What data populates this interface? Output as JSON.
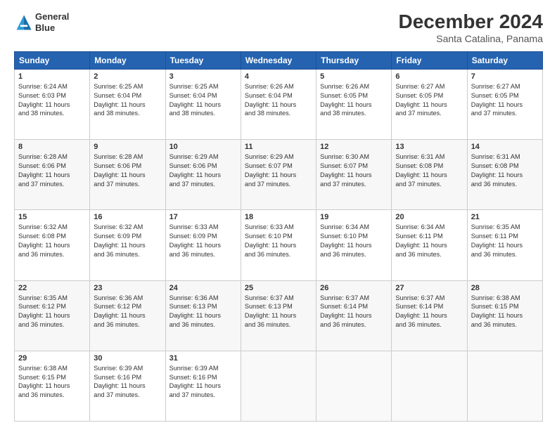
{
  "header": {
    "logo_line1": "General",
    "logo_line2": "Blue",
    "main_title": "December 2024",
    "subtitle": "Santa Catalina, Panama"
  },
  "calendar": {
    "days_of_week": [
      "Sunday",
      "Monday",
      "Tuesday",
      "Wednesday",
      "Thursday",
      "Friday",
      "Saturday"
    ],
    "weeks": [
      [
        {
          "day": "1",
          "info": "Sunrise: 6:24 AM\nSunset: 6:03 PM\nDaylight: 11 hours\nand 38 minutes."
        },
        {
          "day": "2",
          "info": "Sunrise: 6:25 AM\nSunset: 6:04 PM\nDaylight: 11 hours\nand 38 minutes."
        },
        {
          "day": "3",
          "info": "Sunrise: 6:25 AM\nSunset: 6:04 PM\nDaylight: 11 hours\nand 38 minutes."
        },
        {
          "day": "4",
          "info": "Sunrise: 6:26 AM\nSunset: 6:04 PM\nDaylight: 11 hours\nand 38 minutes."
        },
        {
          "day": "5",
          "info": "Sunrise: 6:26 AM\nSunset: 6:05 PM\nDaylight: 11 hours\nand 38 minutes."
        },
        {
          "day": "6",
          "info": "Sunrise: 6:27 AM\nSunset: 6:05 PM\nDaylight: 11 hours\nand 37 minutes."
        },
        {
          "day": "7",
          "info": "Sunrise: 6:27 AM\nSunset: 6:05 PM\nDaylight: 11 hours\nand 37 minutes."
        }
      ],
      [
        {
          "day": "8",
          "info": "Sunrise: 6:28 AM\nSunset: 6:06 PM\nDaylight: 11 hours\nand 37 minutes."
        },
        {
          "day": "9",
          "info": "Sunrise: 6:28 AM\nSunset: 6:06 PM\nDaylight: 11 hours\nand 37 minutes."
        },
        {
          "day": "10",
          "info": "Sunrise: 6:29 AM\nSunset: 6:06 PM\nDaylight: 11 hours\nand 37 minutes."
        },
        {
          "day": "11",
          "info": "Sunrise: 6:29 AM\nSunset: 6:07 PM\nDaylight: 11 hours\nand 37 minutes."
        },
        {
          "day": "12",
          "info": "Sunrise: 6:30 AM\nSunset: 6:07 PM\nDaylight: 11 hours\nand 37 minutes."
        },
        {
          "day": "13",
          "info": "Sunrise: 6:31 AM\nSunset: 6:08 PM\nDaylight: 11 hours\nand 37 minutes."
        },
        {
          "day": "14",
          "info": "Sunrise: 6:31 AM\nSunset: 6:08 PM\nDaylight: 11 hours\nand 36 minutes."
        }
      ],
      [
        {
          "day": "15",
          "info": "Sunrise: 6:32 AM\nSunset: 6:08 PM\nDaylight: 11 hours\nand 36 minutes."
        },
        {
          "day": "16",
          "info": "Sunrise: 6:32 AM\nSunset: 6:09 PM\nDaylight: 11 hours\nand 36 minutes."
        },
        {
          "day": "17",
          "info": "Sunrise: 6:33 AM\nSunset: 6:09 PM\nDaylight: 11 hours\nand 36 minutes."
        },
        {
          "day": "18",
          "info": "Sunrise: 6:33 AM\nSunset: 6:10 PM\nDaylight: 11 hours\nand 36 minutes."
        },
        {
          "day": "19",
          "info": "Sunrise: 6:34 AM\nSunset: 6:10 PM\nDaylight: 11 hours\nand 36 minutes."
        },
        {
          "day": "20",
          "info": "Sunrise: 6:34 AM\nSunset: 6:11 PM\nDaylight: 11 hours\nand 36 minutes."
        },
        {
          "day": "21",
          "info": "Sunrise: 6:35 AM\nSunset: 6:11 PM\nDaylight: 11 hours\nand 36 minutes."
        }
      ],
      [
        {
          "day": "22",
          "info": "Sunrise: 6:35 AM\nSunset: 6:12 PM\nDaylight: 11 hours\nand 36 minutes."
        },
        {
          "day": "23",
          "info": "Sunrise: 6:36 AM\nSunset: 6:12 PM\nDaylight: 11 hours\nand 36 minutes."
        },
        {
          "day": "24",
          "info": "Sunrise: 6:36 AM\nSunset: 6:13 PM\nDaylight: 11 hours\nand 36 minutes."
        },
        {
          "day": "25",
          "info": "Sunrise: 6:37 AM\nSunset: 6:13 PM\nDaylight: 11 hours\nand 36 minutes."
        },
        {
          "day": "26",
          "info": "Sunrise: 6:37 AM\nSunset: 6:14 PM\nDaylight: 11 hours\nand 36 minutes."
        },
        {
          "day": "27",
          "info": "Sunrise: 6:37 AM\nSunset: 6:14 PM\nDaylight: 11 hours\nand 36 minutes."
        },
        {
          "day": "28",
          "info": "Sunrise: 6:38 AM\nSunset: 6:15 PM\nDaylight: 11 hours\nand 36 minutes."
        }
      ],
      [
        {
          "day": "29",
          "info": "Sunrise: 6:38 AM\nSunset: 6:15 PM\nDaylight: 11 hours\nand 36 minutes."
        },
        {
          "day": "30",
          "info": "Sunrise: 6:39 AM\nSunset: 6:16 PM\nDaylight: 11 hours\nand 37 minutes."
        },
        {
          "day": "31",
          "info": "Sunrise: 6:39 AM\nSunset: 6:16 PM\nDaylight: 11 hours\nand 37 minutes."
        },
        null,
        null,
        null,
        null
      ]
    ]
  }
}
